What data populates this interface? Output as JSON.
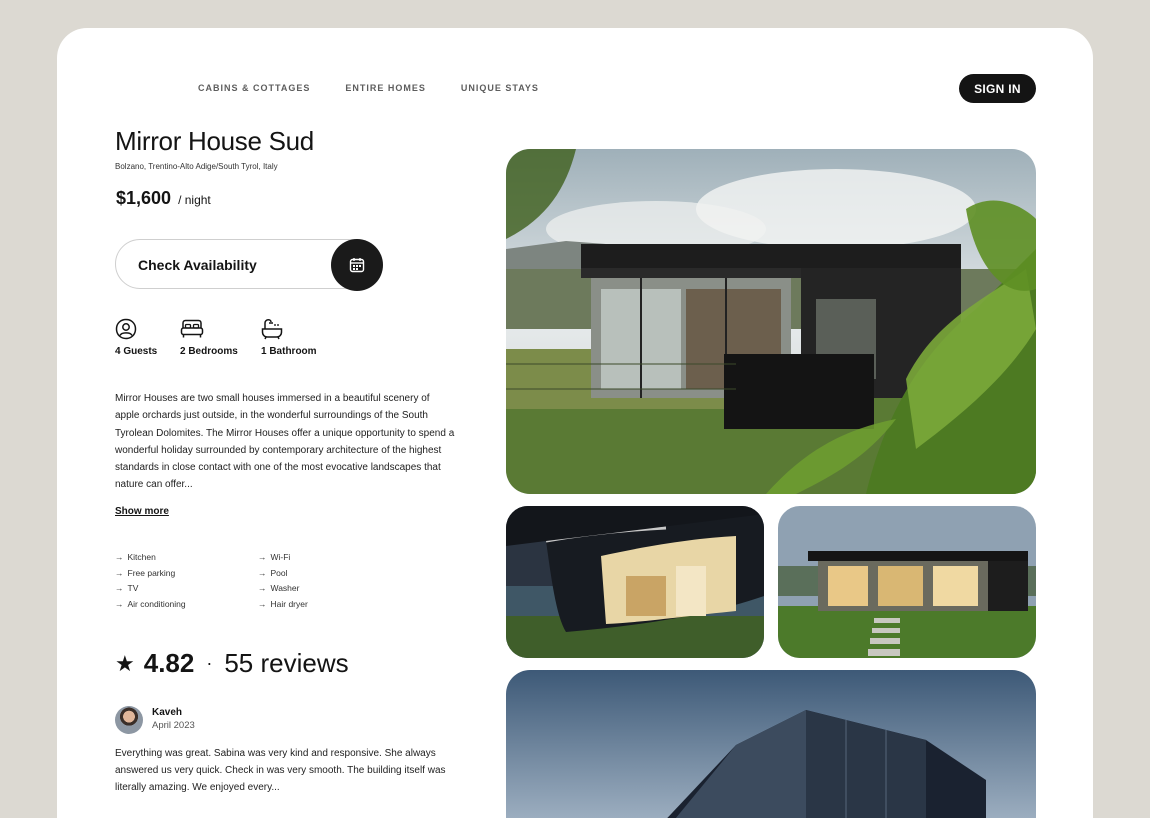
{
  "nav": {
    "cabins": "CABINS & COTTAGES",
    "homes": "ENTIRE HOMES",
    "unique": "UNIQUE STAYS",
    "signin": "SIGN IN"
  },
  "listing": {
    "title": "Mirror House Sud",
    "location": "Bolzano, Trentino-Alto Adige/South Tyrol, Italy",
    "price": "$1,600",
    "price_unit": "/ night",
    "check_availability": "Check Availability",
    "features": [
      {
        "label": "4 Guests",
        "icon": "guest-icon"
      },
      {
        "label": "2 Bedrooms",
        "icon": "bed-icon"
      },
      {
        "label": "1 Bathroom",
        "icon": "bathtub-icon"
      }
    ],
    "description": "Mirror Houses are two small houses immersed in a beautiful scenery of apple orchards just outside, in the wonderful surroundings of the South Tyrolean Dolomites. The Mirror Houses offer a unique opportunity to spend a wonderful holiday surrounded by contemporary architecture of the highest standards in close contact with one of the most evocative landscapes that nature can offer...",
    "show_more": "Show more",
    "amenities_left": [
      "Kitchen",
      "Free parking",
      "TV",
      "Air conditioning"
    ],
    "amenities_right": [
      "Wi-Fi",
      "Pool",
      "Washer",
      "Hair dryer"
    ]
  },
  "rating": {
    "score": "4.82",
    "separator": "·",
    "reviews": "55 reviews"
  },
  "review": {
    "name": "Kaveh",
    "date": "April 2023",
    "text": "Everything was great. Sabina was very kind and responsive. She always answered us very quick. Check in was very smooth. The building itself was literally amazing. We enjoyed every..."
  },
  "colors": {
    "background": "#dcd9d2",
    "card": "#ffffff",
    "accent_dark": "#141414"
  }
}
